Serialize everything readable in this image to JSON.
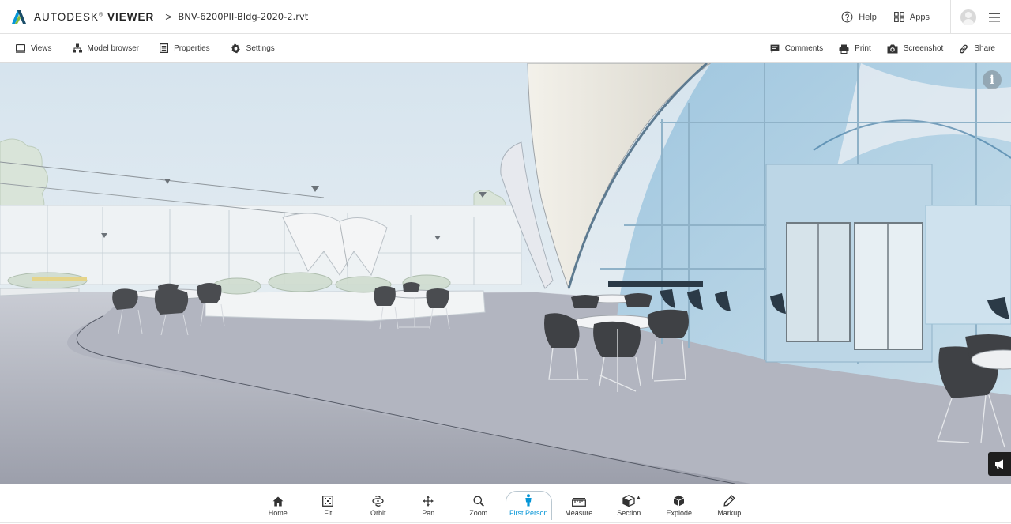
{
  "header": {
    "brand_prefix": "AUTODESK",
    "brand_reg": "®",
    "brand_suffix": "VIEWER",
    "separator": ">",
    "filename": "BNV-6200PII-Bldg-2020-2.rvt",
    "help_label": "Help",
    "apps_label": "Apps"
  },
  "toolbar": {
    "left": [
      {
        "label": "Views",
        "icon": "monitor-icon"
      },
      {
        "label": "Model browser",
        "icon": "hierarchy-icon"
      },
      {
        "label": "Properties",
        "icon": "document-icon"
      },
      {
        "label": "Settings",
        "icon": "gear-icon"
      }
    ],
    "right": [
      {
        "label": "Comments",
        "icon": "comment-icon"
      },
      {
        "label": "Print",
        "icon": "printer-icon"
      },
      {
        "label": "Screenshot",
        "icon": "camera-icon"
      },
      {
        "label": "Share",
        "icon": "link-icon"
      }
    ]
  },
  "viewport": {
    "info_glyph": "i"
  },
  "bottom_tools": [
    {
      "label": "Home",
      "icon": "home-icon"
    },
    {
      "label": "Fit",
      "icon": "fit-icon"
    },
    {
      "label": "Orbit",
      "icon": "orbit-icon"
    },
    {
      "label": "Pan",
      "icon": "pan-icon"
    },
    {
      "label": "Zoom",
      "icon": "zoom-icon"
    },
    {
      "label": "First Person",
      "icon": "person-icon",
      "active": true
    },
    {
      "label": "Measure",
      "icon": "ruler-icon"
    },
    {
      "label": "Section",
      "icon": "section-box-icon",
      "caret": "▲"
    },
    {
      "label": "Explode",
      "icon": "cube-icon"
    },
    {
      "label": "Markup",
      "icon": "pen-icon"
    }
  ],
  "colors": {
    "accent": "#0696d7",
    "logo_teal": "#0696d7",
    "logo_green": "#87bc40",
    "sky": "#dfe9f0",
    "floor": "#a7aab6",
    "glass": "#aacde3"
  }
}
